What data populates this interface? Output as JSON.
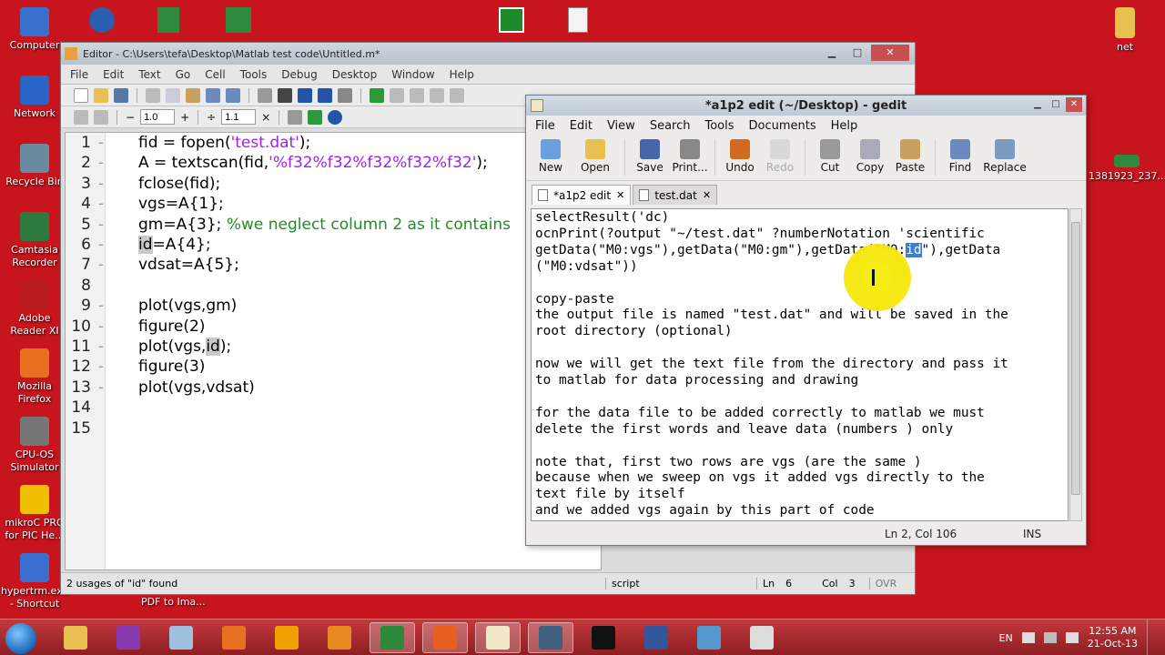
{
  "desktop": {
    "left_icons": [
      {
        "label": "Computer"
      },
      {
        "label": "Network"
      },
      {
        "label": "Recycle Bin"
      },
      {
        "label": "Camtasia Recorder"
      },
      {
        "label": "Adobe Reader XI"
      },
      {
        "label": "Mozilla Firefox"
      },
      {
        "label": "CPU-OS Simulator"
      },
      {
        "label": "mikroC PRO for PIC He..."
      },
      {
        "label": "hypertrm.exe - Shortcut"
      }
    ],
    "right_icons": [
      {
        "label": "net"
      },
      {
        "label": "1381923_237..."
      }
    ],
    "below_editor_label": "PDF to Ima..."
  },
  "matlab_editor": {
    "title": "Editor - C:\\Users\\tefa\\Desktop\\Matlab test code\\Untitled.m*",
    "menu": [
      "File",
      "Edit",
      "Text",
      "Go",
      "Cell",
      "Tools",
      "Debug",
      "Desktop",
      "Window",
      "Help"
    ],
    "cell_toolbar": {
      "minus": "−",
      "value1": "1.0",
      "plus": "+",
      "divide": "÷",
      "value2": "1.1",
      "times": "×"
    },
    "code_lines": [
      {
        "num": "1",
        "parts": [
          {
            "t": "fid = fopen(",
            "c": ""
          },
          {
            "t": "'test.dat'",
            "c": "str"
          },
          {
            "t": ");",
            "c": ""
          }
        ]
      },
      {
        "num": "2",
        "parts": [
          {
            "t": "A = textscan(fid,",
            "c": ""
          },
          {
            "t": "'%f32%f32%f32%f32%f32'",
            "c": "str"
          },
          {
            "t": ");",
            "c": ""
          }
        ]
      },
      {
        "num": "3",
        "parts": [
          {
            "t": "fclose(fid);",
            "c": ""
          }
        ]
      },
      {
        "num": "4",
        "parts": [
          {
            "t": "vgs=A{1};",
            "c": ""
          }
        ]
      },
      {
        "num": "5",
        "parts": [
          {
            "t": "gm=A{3}; ",
            "c": ""
          },
          {
            "t": "%we neglect column 2 as it contains",
            "c": "cmt"
          }
        ]
      },
      {
        "num": "6",
        "parts": [
          {
            "t": "id",
            "c": "hl"
          },
          {
            "t": "=A{4};",
            "c": ""
          }
        ]
      },
      {
        "num": "7",
        "parts": [
          {
            "t": "vdsat=A{5};",
            "c": ""
          }
        ]
      },
      {
        "num": "8",
        "parts": [
          {
            "t": "",
            "c": ""
          }
        ]
      },
      {
        "num": "9",
        "parts": [
          {
            "t": "plot(vgs,gm)",
            "c": ""
          }
        ]
      },
      {
        "num": "10",
        "parts": [
          {
            "t": "figure(2)",
            "c": ""
          }
        ]
      },
      {
        "num": "11",
        "parts": [
          {
            "t": "plot(vgs,",
            "c": ""
          },
          {
            "t": "id",
            "c": "hl"
          },
          {
            "t": ");",
            "c": ""
          }
        ]
      },
      {
        "num": "12",
        "parts": [
          {
            "t": "figure(3)",
            "c": ""
          }
        ]
      },
      {
        "num": "13",
        "parts": [
          {
            "t": "plot(vgs,vdsat)",
            "c": ""
          }
        ]
      },
      {
        "num": "14",
        "parts": [
          {
            "t": "",
            "c": ""
          }
        ]
      },
      {
        "num": "15",
        "parts": [
          {
            "t": "",
            "c": ""
          }
        ]
      }
    ],
    "status": {
      "message": "2 usages of \"id\" found",
      "mode": "script",
      "ln_label": "Ln",
      "ln": "6",
      "col_label": "Col",
      "col": "3",
      "ovr": "OVR"
    }
  },
  "gedit": {
    "title": "*a1p2 edit (~/Desktop) - gedit",
    "menu": [
      "File",
      "Edit",
      "View",
      "Search",
      "Tools",
      "Documents",
      "Help"
    ],
    "toolbar": [
      {
        "label": "New",
        "icon": "new-document-icon",
        "enabled": true
      },
      {
        "label": "Open",
        "icon": "open-folder-icon",
        "enabled": true
      },
      {
        "label": "Save",
        "icon": "save-disk-icon",
        "enabled": true
      },
      {
        "label": "Print...",
        "icon": "printer-icon",
        "enabled": true
      },
      {
        "label": "Undo",
        "icon": "undo-arrow-icon",
        "enabled": true
      },
      {
        "label": "Redo",
        "icon": "redo-arrow-icon",
        "enabled": false
      },
      {
        "label": "Cut",
        "icon": "scissors-icon",
        "enabled": true
      },
      {
        "label": "Copy",
        "icon": "copy-icon",
        "enabled": true
      },
      {
        "label": "Paste",
        "icon": "paste-clipboard-icon",
        "enabled": true
      },
      {
        "label": "Find",
        "icon": "find-magnifier-icon",
        "enabled": true
      },
      {
        "label": "Replace",
        "icon": "replace-icon",
        "enabled": true
      }
    ],
    "tabs": [
      {
        "label": "*a1p2 edit",
        "active": true
      },
      {
        "label": "test.dat",
        "active": false
      }
    ],
    "text_lines": [
      {
        "pre": "selectResult('dc)",
        "sel": "",
        "post": ""
      },
      {
        "pre": "ocnPrint(?output \"~/test.dat\" ?numberNotation 'scientific",
        "sel": "",
        "post": ""
      },
      {
        "pre": "getData(\"M0:vgs\"),getData(\"M0:gm\"),getData(\"M0:",
        "sel": "id",
        "post": "\"),getData"
      },
      {
        "pre": "(\"M0:vdsat\"))",
        "sel": "",
        "post": ""
      },
      {
        "pre": "",
        "sel": "",
        "post": ""
      },
      {
        "pre": "copy-paste",
        "sel": "",
        "post": ""
      },
      {
        "pre": "the output file is named \"test.dat\" and will be saved in the",
        "sel": "",
        "post": ""
      },
      {
        "pre": "root directory (optional)",
        "sel": "",
        "post": ""
      },
      {
        "pre": "",
        "sel": "",
        "post": ""
      },
      {
        "pre": "now we will get the text file from the directory and pass it",
        "sel": "",
        "post": ""
      },
      {
        "pre": "to matlab for data processing and drawing",
        "sel": "",
        "post": ""
      },
      {
        "pre": "",
        "sel": "",
        "post": ""
      },
      {
        "pre": "for the data file to be added correctly to matlab we must",
        "sel": "",
        "post": ""
      },
      {
        "pre": "delete the first words and leave data (numbers ) only",
        "sel": "",
        "post": ""
      },
      {
        "pre": "",
        "sel": "",
        "post": ""
      },
      {
        "pre": "note that, first two rows are vgs (are the same )",
        "sel": "",
        "post": ""
      },
      {
        "pre": "because when we sweep on vgs it added vgs directly to the",
        "sel": "",
        "post": ""
      },
      {
        "pre": "text file by itself",
        "sel": "",
        "post": ""
      },
      {
        "pre": "and we added vgs again by this part of code",
        "sel": "",
        "post": ""
      }
    ],
    "status": {
      "position": "Ln 2, Col 106",
      "mode": "INS"
    }
  },
  "taskbar": {
    "items": [
      {
        "icon": "explorer-icon"
      },
      {
        "icon": "yahoo-messenger-icon"
      },
      {
        "icon": "notepad-icon"
      },
      {
        "icon": "firefox-icon"
      },
      {
        "icon": "avast-icon"
      },
      {
        "icon": "vlc-icon"
      },
      {
        "icon": "camtasia-icon"
      },
      {
        "icon": "matlab-icon"
      },
      {
        "icon": "gedit-icon"
      },
      {
        "icon": "network-icon"
      },
      {
        "icon": "terminal-icon"
      },
      {
        "icon": "cmd-icon"
      },
      {
        "icon": "monitor-icon"
      },
      {
        "icon": "calculator-icon"
      }
    ],
    "language": "EN",
    "time": "12:55 AM",
    "date": "21-Oct-13"
  },
  "colors": {
    "desktop_bg": "#c8141c",
    "matlab_string": "#a020f0",
    "matlab_comment": "#228b22",
    "selection": "#3a7fd0"
  }
}
